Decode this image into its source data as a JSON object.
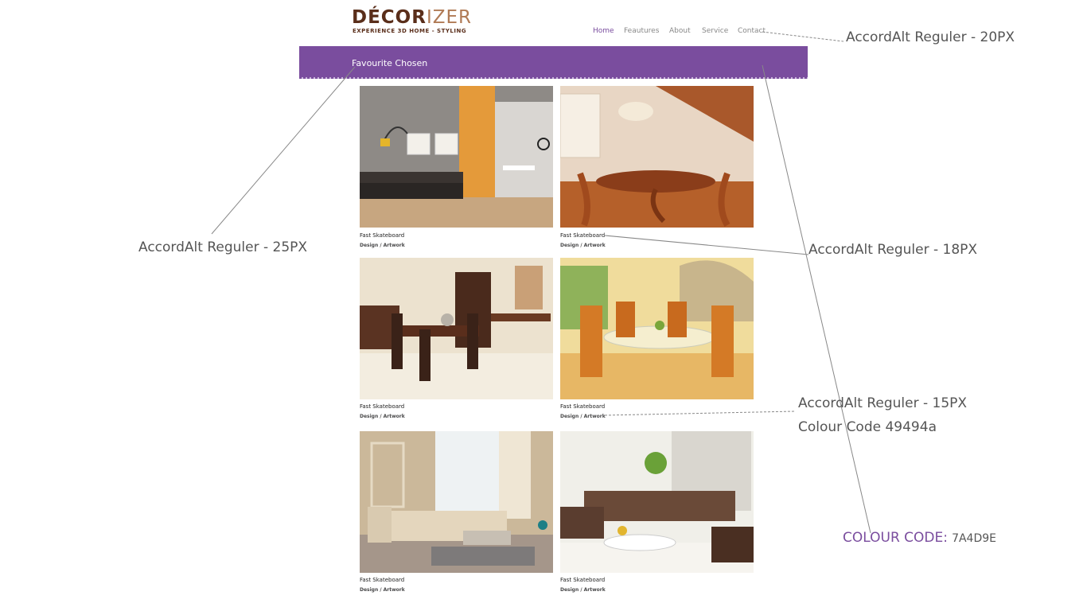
{
  "logo": {
    "part_dark": "DÉCOR",
    "part_light": "IZER",
    "tagline": "EXPERIENCE 3D HOME - STYLING"
  },
  "nav": {
    "home": "Home",
    "features": "Feautures",
    "about": "About",
    "service": "Service",
    "contact": "Contact"
  },
  "banner": {
    "title": "Favourite Chosen"
  },
  "cards": [
    {
      "title": "Fast Skateboard",
      "subtitle": "Design / Artwork",
      "image": "living-room-orange-wall"
    },
    {
      "title": "Fast Skateboard",
      "subtitle": "Design / Artwork",
      "image": "dining-room-wood-attic"
    },
    {
      "title": "Fast Skateboard",
      "subtitle": "Design / Artwork",
      "image": "dining-room-dark-wood"
    },
    {
      "title": "Fast Skateboard",
      "subtitle": "Design / Artwork",
      "image": "dining-room-orange-chairs"
    },
    {
      "title": "Fast Skateboard",
      "subtitle": "Design / Artwork",
      "image": "living-room-beige-sofa"
    },
    {
      "title": "Fast Skateboard",
      "subtitle": "Design / Artwork",
      "image": "living-room-brown-sofa"
    }
  ],
  "annotations": {
    "nav_font": "AccordAlt Reguler - 20PX",
    "banner_font": "AccordAlt Reguler - 25PX",
    "title_font": "AccordAlt Reguler - 18PX",
    "sub_font": "AccordAlt Reguler - 15PX",
    "sub_colour": "Colour Code 49494a",
    "colour_label": "COLOUR CODE:",
    "colour_value": "7A4D9E"
  },
  "colors": {
    "accent": "#7a4d9e",
    "subtext": "#49494a",
    "brand_dark": "#5a2e1a"
  }
}
